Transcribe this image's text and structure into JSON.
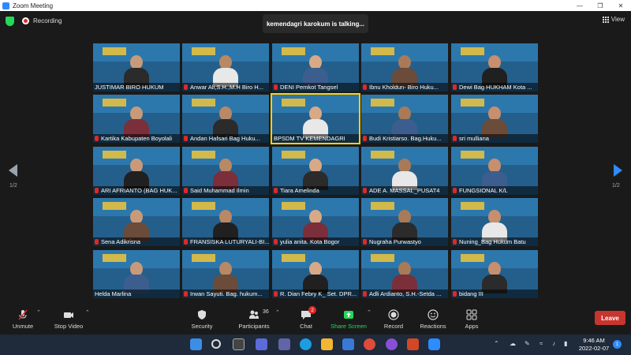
{
  "window": {
    "title": "Zoom Meeting"
  },
  "topbar": {
    "recording_label": "Recording",
    "talking": "kemendagri karokum is talking...",
    "view_label": "View"
  },
  "pagination": {
    "left": "1/2",
    "right": "1/2"
  },
  "participants": [
    {
      "name": "JUSTIMAR BIRO HUKUM",
      "muted": false
    },
    {
      "name": "Anwar Ali,S.H.,M.H Biro H...",
      "muted": true
    },
    {
      "name": "DENI Pemkot Tangsel",
      "muted": true
    },
    {
      "name": "Ibnu Kholdun- Biro Huku...",
      "muted": true
    },
    {
      "name": "Dewi Bag HUKHAM Kota ...",
      "muted": true
    },
    {
      "name": "Kartika Kabupaten Boyolali",
      "muted": true
    },
    {
      "name": "Andan Hafsari Bag Huku...",
      "muted": true
    },
    {
      "name": "BPSDM TV KEMENDAGRI",
      "muted": false
    },
    {
      "name": "Budi Kristiarso. Bag.Huku...",
      "muted": true
    },
    {
      "name": "sri mulliana",
      "muted": true
    },
    {
      "name": "ARI AFRIANTO (BAG HUK...",
      "muted": true
    },
    {
      "name": "Said Muhammad Ilmin",
      "muted": true
    },
    {
      "name": "Tiara Amelinda",
      "muted": true
    },
    {
      "name": "ADE A. MASSAL_PUSAT4",
      "muted": true
    },
    {
      "name": "FUNGSIONAL K/L",
      "muted": true
    },
    {
      "name": "Sena Adikrisna",
      "muted": true
    },
    {
      "name": "FRANSISKA LUTURYALI-BI...",
      "muted": true
    },
    {
      "name": "yulia anita. Kota Bogor",
      "muted": true
    },
    {
      "name": "Nugraha Purwastyo",
      "muted": true
    },
    {
      "name": "Nuning_Bag Hukum Batu",
      "muted": true
    },
    {
      "name": "Helda Marlina",
      "muted": false
    },
    {
      "name": "Irwan Sayuti. Bag. hukum...",
      "muted": true
    },
    {
      "name": "R. Dian Febry K_ Set. DPR...",
      "muted": true
    },
    {
      "name": "Adli Ardianto, S.H.-Setda ...",
      "muted": true
    },
    {
      "name": "bidang III",
      "muted": true
    }
  ],
  "toolbar": {
    "unmute": "Unmute",
    "stop_video": "Stop Video",
    "security": "Security",
    "participants": "Participants",
    "participants_count": "36",
    "chat": "Chat",
    "chat_badge": "2",
    "share_screen": "Share Screen",
    "record": "Record",
    "reactions": "Reactions",
    "apps": "Apps",
    "leave": "Leave"
  },
  "taskbar": {
    "time": "9:46 AM",
    "date": "2022-02-07",
    "notifications": "1"
  },
  "colors": {
    "accent": "#2d8cff",
    "leave": "#c8352e",
    "share": "#23d959",
    "active_speaker": "#ffd400"
  }
}
